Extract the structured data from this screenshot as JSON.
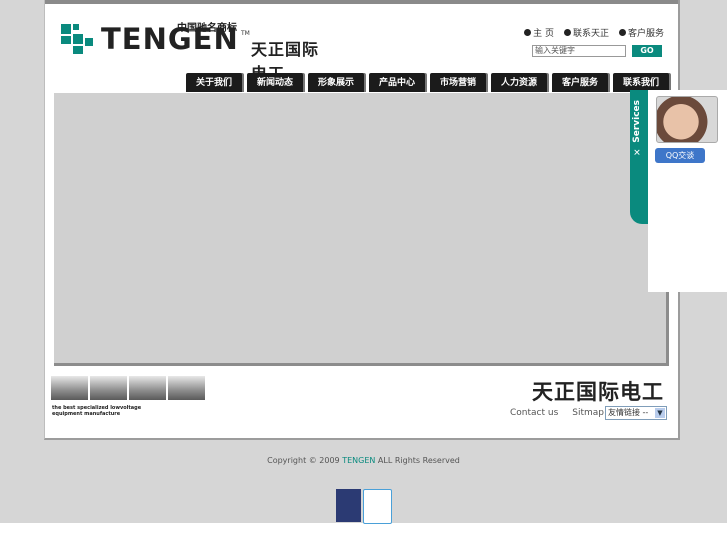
{
  "header": {
    "logo_cn_top": "中国驰名商标",
    "logo_en": "TENGEN",
    "logo_tm": "TM",
    "logo_cn": "天正国际电工",
    "top_links": [
      "主 页",
      "联系天正",
      "客户服务"
    ],
    "search_placeholder": "输入关键字",
    "go_label": "GO"
  },
  "nav": [
    "关于我们",
    "新闻动态",
    "形象展示",
    "产品中心",
    "市场营销",
    "人力资源",
    "客户服务",
    "联系我们"
  ],
  "footer": {
    "tagline": "the best specialized lowvoltage equipment manufacture",
    "brand_cn": "天正国际电工",
    "links": [
      "Contact us",
      "Sitmap"
    ],
    "select_value": "友情链接 --"
  },
  "copyright": {
    "prefix": "Copyright © 2009",
    "brand": "TENGEN",
    "suffix": "ALL Rights Reserved"
  },
  "services": {
    "tab_label": "✕ Services",
    "qq_label": "QQ交谈"
  },
  "colors": {
    "accent": "#0a8a7e",
    "nav_bg": "#1b1b1b"
  }
}
